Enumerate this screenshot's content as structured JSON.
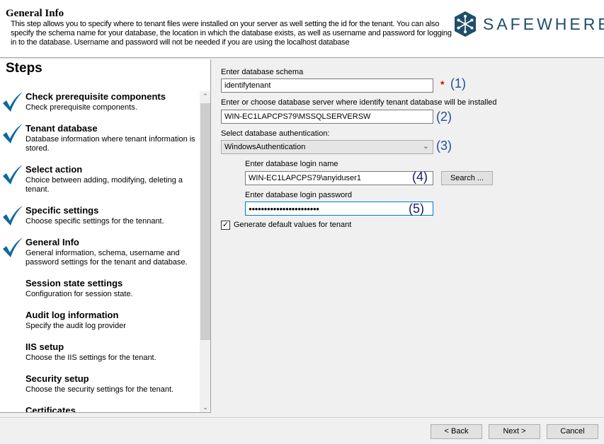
{
  "header": {
    "title": "General Info",
    "description": "This step allows you to specify where to tenant files were installed on your server as well setting the id for the tenant. You can also specify the schema name for your database, the location in which the database exists, as well as username and password for logging in to the database. Username and password will not be needed if you are using the localhost database",
    "logo_text": "SAFEWHERE",
    "brand_color": "#1f4e6b"
  },
  "steps": {
    "title": "Steps",
    "items": [
      {
        "title": "Check prerequisite components",
        "desc": "Check prerequisite components.",
        "done": true
      },
      {
        "title": "Tenant database",
        "desc": "Database information where tenant information is stored.",
        "done": true
      },
      {
        "title": "Select action",
        "desc": "Choice between adding, modifying, deleting a tenant.",
        "done": true
      },
      {
        "title": "Specific settings",
        "desc": "Choose specific settings for the tennant.",
        "done": true
      },
      {
        "title": "General Info",
        "desc": "General information, schema, username and password settings for the tenant and database.",
        "done": true
      },
      {
        "title": "Session state settings",
        "desc": "Configuration for session state.",
        "done": false
      },
      {
        "title": "Audit log information",
        "desc": "Specify the audit log provider",
        "done": false
      },
      {
        "title": "IIS setup",
        "desc": "Choose the IIS settings for the tenant.",
        "done": false
      },
      {
        "title": "Security setup",
        "desc": "Choose the security settings for the tenant.",
        "done": false
      },
      {
        "title": "Certificates",
        "desc": "",
        "done": false
      }
    ]
  },
  "form": {
    "schema_label": "Enter database schema",
    "schema_value": "identifytenant",
    "required_mark": "*",
    "n1": "(1)",
    "server_label": "Enter or choose database server where identify tenant database will be installed",
    "server_value": "WIN-EC1LAPCPS79\\MSSQLSERVERSW",
    "n2": "(2)",
    "auth_label": "Select database authentication:",
    "auth_value": "WindowsAuthentication",
    "n3": "(3)",
    "login_label": "Enter database login name",
    "login_value": "WIN-EC1LAPCPS79\\anyiduser1",
    "n4": "(4)",
    "search_label": "Search ...",
    "password_label": "Enter database login password",
    "password_value": "●●●●●●●●●●●●●●●●●●●●●●●",
    "n5": "(5)",
    "generate_label": "Generate default values for tenant",
    "generate_checked": true
  },
  "footer": {
    "back": "< Back",
    "next": "Next >",
    "cancel": "Cancel"
  }
}
